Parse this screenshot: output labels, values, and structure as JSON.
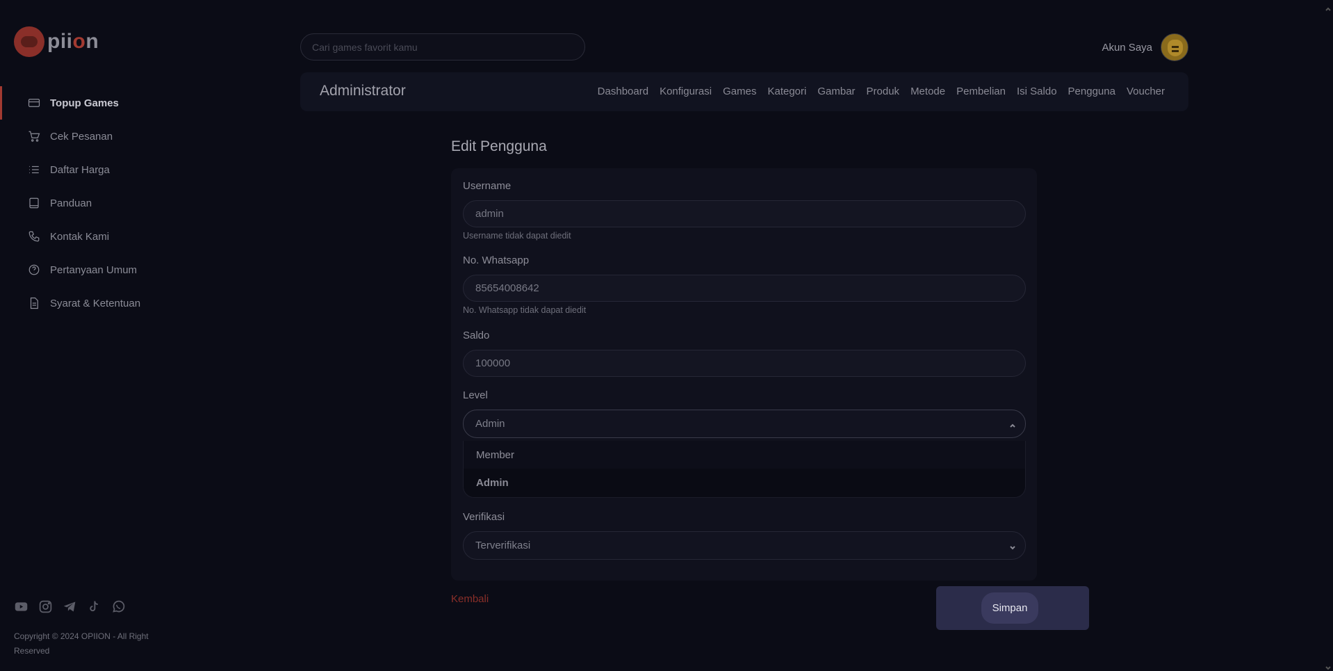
{
  "brand": {
    "logo_text_pre": "pii",
    "logo_text_o": "o",
    "logo_text_post": "n"
  },
  "search": {
    "placeholder": "Cari games favorit kamu"
  },
  "account": {
    "label": "Akun Saya"
  },
  "sidebar": {
    "items": [
      {
        "label": "Topup Games",
        "icon": "credit-card-icon",
        "active": true
      },
      {
        "label": "Cek Pesanan",
        "icon": "cart-icon"
      },
      {
        "label": "Daftar Harga",
        "icon": "list-icon"
      },
      {
        "label": "Panduan",
        "icon": "book-icon"
      },
      {
        "label": "Kontak Kami",
        "icon": "phone-icon"
      },
      {
        "label": "Pertanyaan Umum",
        "icon": "question-icon"
      },
      {
        "label": "Syarat & Ketentuan",
        "icon": "document-icon"
      }
    ],
    "socials": [
      "youtube-icon",
      "instagram-icon",
      "telegram-icon",
      "tiktok-icon",
      "whatsapp-icon"
    ],
    "copyright": "Copyright © 2024 OPIION - All Right Reserved"
  },
  "admin": {
    "title": "Administrator",
    "links": [
      "Dashboard",
      "Konfigurasi",
      "Games",
      "Kategori",
      "Gambar",
      "Produk",
      "Metode",
      "Pembelian",
      "Isi Saldo",
      "Pengguna",
      "Voucher"
    ]
  },
  "form": {
    "title": "Edit Pengguna",
    "username": {
      "label": "Username",
      "value": "admin",
      "hint": "Username tidak dapat diedit"
    },
    "whatsapp": {
      "label": "No. Whatsapp",
      "value": "85654008642",
      "hint": "No. Whatsapp tidak dapat diedit"
    },
    "saldo": {
      "label": "Saldo",
      "value": "100000"
    },
    "level": {
      "label": "Level",
      "value": "Admin",
      "options": [
        "Member",
        "Admin"
      ]
    },
    "verifikasi": {
      "label": "Verifikasi",
      "value": "Terverifikasi"
    },
    "back_label": "Kembali",
    "save_label": "Simpan"
  },
  "colors": {
    "background": "#0b0c16",
    "accent": "#a23a31",
    "card": "#10111d",
    "save_bg": "#2b2c4a"
  }
}
